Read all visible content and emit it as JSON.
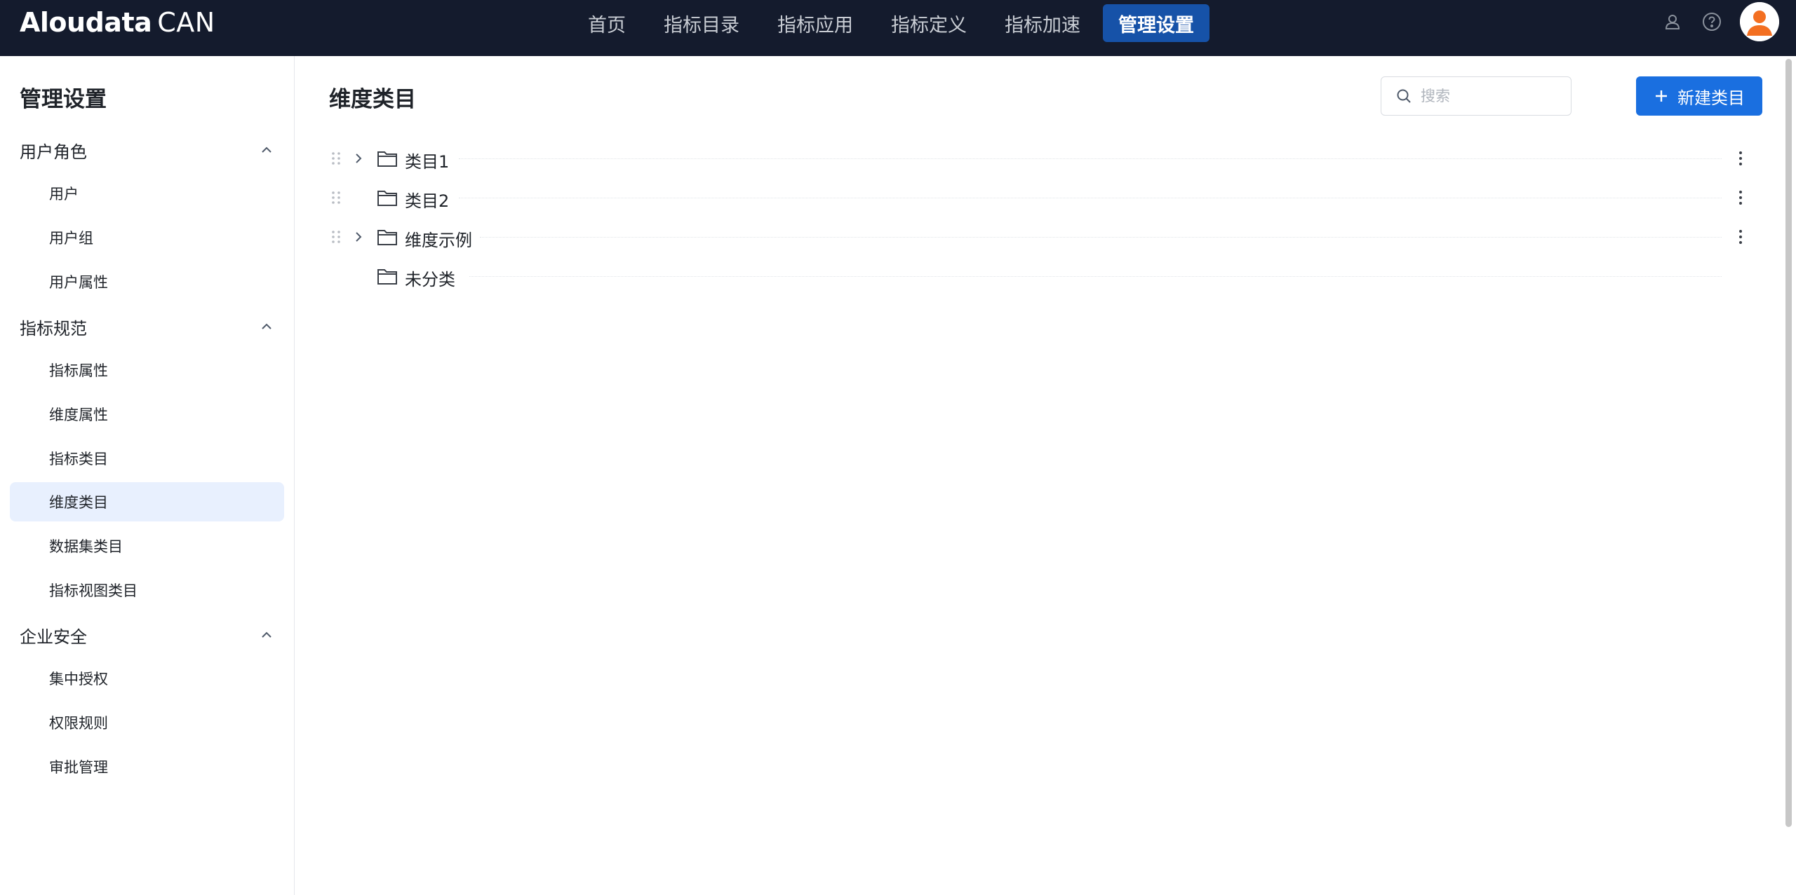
{
  "app": {
    "brand": "Aloudata",
    "product": "CAN"
  },
  "nav": {
    "items": [
      {
        "label": "首页",
        "active": false
      },
      {
        "label": "指标目录",
        "active": false
      },
      {
        "label": "指标应用",
        "active": false
      },
      {
        "label": "指标定义",
        "active": false
      },
      {
        "label": "指标加速",
        "active": false
      },
      {
        "label": "管理设置",
        "active": true
      }
    ]
  },
  "header_icons": [
    "user-outline-icon",
    "help-icon",
    "avatar-icon"
  ],
  "sidebar": {
    "title": "管理设置",
    "groups": [
      {
        "label": "用户角色",
        "items": [
          "用户",
          "用户组",
          "用户属性"
        ]
      },
      {
        "label": "指标规范",
        "items": [
          "指标属性",
          "维度属性",
          "指标类目",
          "维度类目",
          "数据集类目",
          "指标视图类目"
        ]
      },
      {
        "label": "企业安全",
        "items": [
          "集中授权",
          "权限规则",
          "审批管理"
        ]
      }
    ],
    "active_item": "维度类目"
  },
  "main": {
    "title": "维度类目",
    "search": {
      "placeholder": "搜索",
      "value": ""
    },
    "new_button": "新建类目",
    "tree": [
      {
        "label": "类目1",
        "expandable": true,
        "draggable": true,
        "has_menu": true
      },
      {
        "label": "类目2",
        "expandable": false,
        "draggable": true,
        "has_menu": true
      },
      {
        "label": "维度示例",
        "expandable": true,
        "draggable": true,
        "has_menu": true
      },
      {
        "label": "未分类",
        "expandable": false,
        "draggable": false,
        "has_menu": false
      }
    ]
  },
  "colors": {
    "topbar_bg": "#141b2d",
    "nav_active_bg": "#1652a8",
    "primary": "#1a6fe0",
    "sidebar_active_bg": "#e8f0fe",
    "avatar": "#f36f21"
  }
}
